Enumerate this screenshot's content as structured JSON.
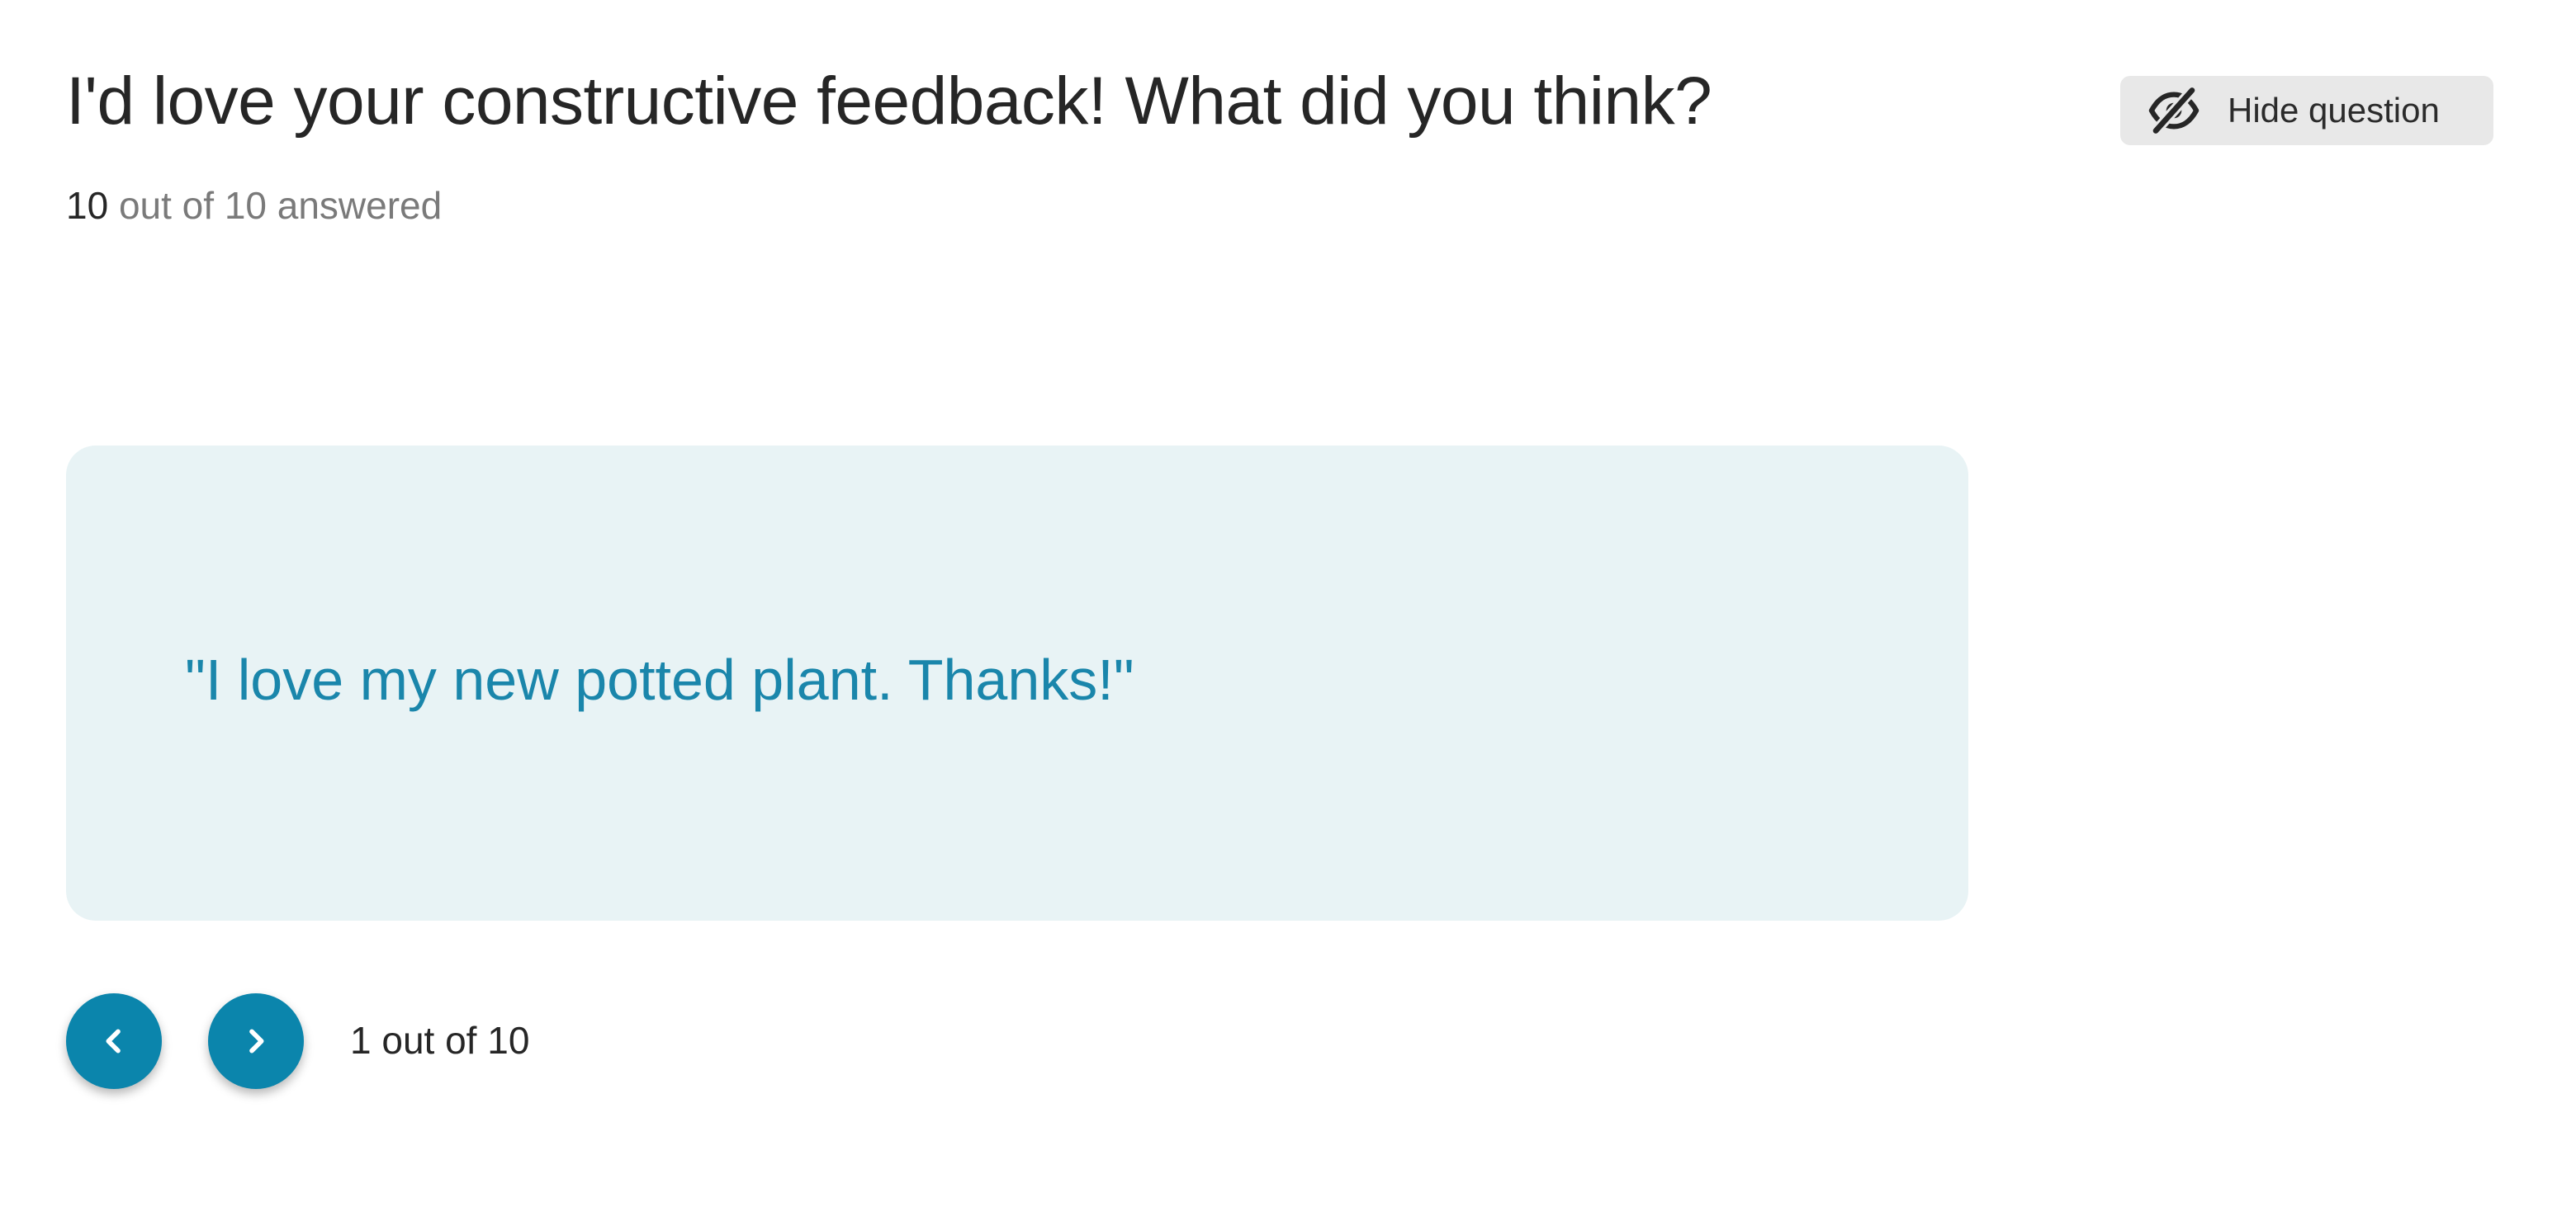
{
  "question": {
    "title": "I'd love your constructive feedback! What did you think?",
    "answered_count": "10",
    "answered_suffix": " out of 10 answered"
  },
  "hide_button": {
    "label": "Hide question",
    "icon": "eye-slash-icon"
  },
  "response": {
    "text": "\"I love my new potted plant. Thanks!\""
  },
  "pagination": {
    "prev_icon": "chevron-left-icon",
    "next_icon": "chevron-right-icon",
    "status": "1 out of 10"
  },
  "colors": {
    "accent": "#0b85ac",
    "quote_text": "#1a86ab",
    "card_bg": "#e8f3f5",
    "button_bg": "#e8e8e8"
  }
}
